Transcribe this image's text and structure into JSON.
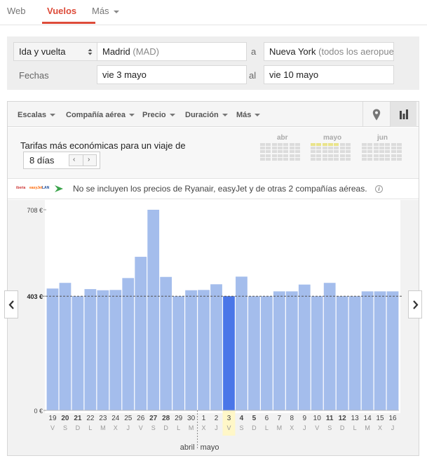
{
  "nav": {
    "tabs": [
      {
        "label": "Web",
        "active": false
      },
      {
        "label": "Vuelos",
        "active": true
      },
      {
        "label": "Más",
        "active": false
      }
    ]
  },
  "search": {
    "trip_type": "Ida y vuelta",
    "origin": "Madrid",
    "origin_code": "(MAD)",
    "to_label": "a",
    "destination": "Nueva York",
    "destination_note": "(todos los aeropue",
    "dates_label": "Fechas",
    "depart_date": "vie 3 mayo",
    "date_sep": "al",
    "return_date": "vie 10 mayo"
  },
  "toolbar": {
    "filters": [
      "Escalas",
      "Compañía aérea",
      "Precio",
      "Duración",
      "Más"
    ],
    "map_icon": "map-pin-icon",
    "chart_icon": "bar-chart-icon"
  },
  "trip_length": {
    "label": "Tarifas más económicas para un viaje de",
    "value": "8 días"
  },
  "calendar_months": [
    "abr",
    "mayo",
    "jun"
  ],
  "notice": {
    "text": "No se incluyen los precios de Ryanair, easyJet y de otras 2 compañías aéreas.",
    "airline_logos": [
      "iberia",
      "easyJet",
      "LAN"
    ]
  },
  "colors": {
    "bar": "#a4bdec",
    "bar_selected": "#4a76e8",
    "accent": "#dd4b39",
    "selected_day_bg": "#fff7c8"
  },
  "chart_data": {
    "type": "bar",
    "ylim": [
      0,
      708
    ],
    "y_ticks": [
      "708 €",
      "403 €",
      "0 €"
    ],
    "y_tick_values": [
      708,
      403,
      0
    ],
    "reference_value": 403,
    "x": [
      {
        "day": "19",
        "dow": "V",
        "bold": false
      },
      {
        "day": "20",
        "dow": "S",
        "bold": true
      },
      {
        "day": "21",
        "dow": "D",
        "bold": true
      },
      {
        "day": "22",
        "dow": "L",
        "bold": false
      },
      {
        "day": "23",
        "dow": "M",
        "bold": false
      },
      {
        "day": "24",
        "dow": "X",
        "bold": false
      },
      {
        "day": "25",
        "dow": "J",
        "bold": false
      },
      {
        "day": "26",
        "dow": "V",
        "bold": false
      },
      {
        "day": "27",
        "dow": "S",
        "bold": true
      },
      {
        "day": "28",
        "dow": "D",
        "bold": true
      },
      {
        "day": "29",
        "dow": "L",
        "bold": false
      },
      {
        "day": "30",
        "dow": "M",
        "bold": false
      },
      {
        "day": "1",
        "dow": "X",
        "bold": false
      },
      {
        "day": "2",
        "dow": "J",
        "bold": false
      },
      {
        "day": "3",
        "dow": "V",
        "bold": false
      },
      {
        "day": "4",
        "dow": "S",
        "bold": true
      },
      {
        "day": "5",
        "dow": "D",
        "bold": true
      },
      {
        "day": "6",
        "dow": "L",
        "bold": false
      },
      {
        "day": "7",
        "dow": "M",
        "bold": false
      },
      {
        "day": "8",
        "dow": "X",
        "bold": false
      },
      {
        "day": "9",
        "dow": "J",
        "bold": false
      },
      {
        "day": "10",
        "dow": "V",
        "bold": false
      },
      {
        "day": "11",
        "dow": "S",
        "bold": true
      },
      {
        "day": "12",
        "dow": "D",
        "bold": true
      },
      {
        "day": "13",
        "dow": "L",
        "bold": false
      },
      {
        "day": "14",
        "dow": "M",
        "bold": false
      },
      {
        "day": "15",
        "dow": "X",
        "bold": false
      },
      {
        "day": "16",
        "dow": "J",
        "bold": false
      }
    ],
    "values": [
      430,
      450,
      403,
      428,
      424,
      425,
      467,
      542,
      708,
      471,
      403,
      424,
      425,
      445,
      403,
      472,
      403,
      403,
      420,
      420,
      444,
      403,
      450,
      403,
      403,
      420,
      420,
      420
    ],
    "selected_index": 14,
    "month_labels": [
      "abril",
      "mayo"
    ],
    "month_boundary_index": 12
  }
}
